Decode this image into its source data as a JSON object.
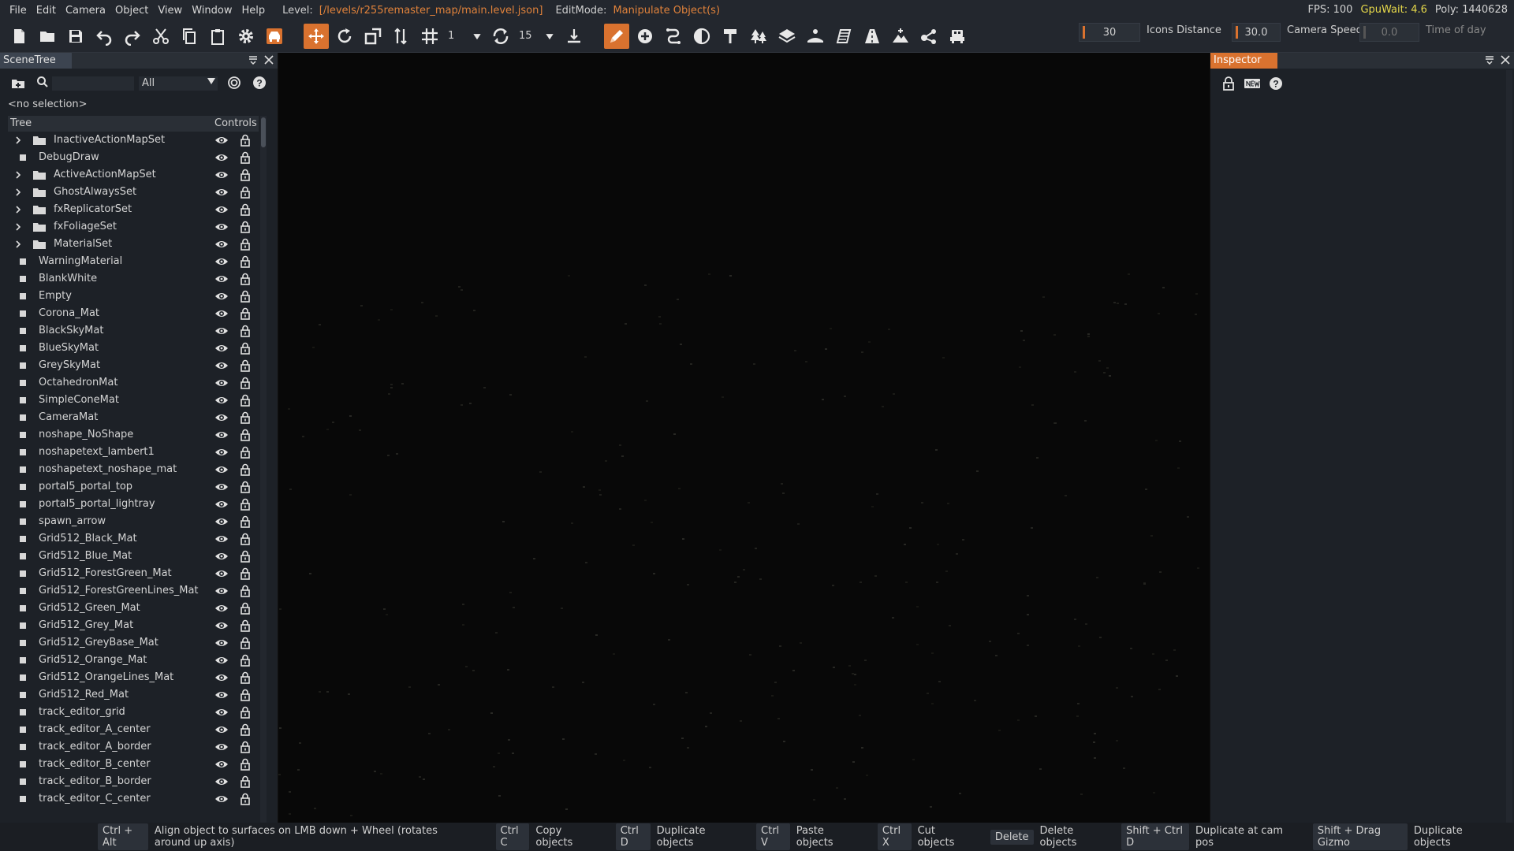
{
  "menu": {
    "items": [
      "File",
      "Edit",
      "Camera",
      "Object",
      "View",
      "Window",
      "Help"
    ],
    "level_label": "Level:",
    "level_path": "[/levels/r255remaster_map/main.level.json]",
    "editmode_label": "EditMode:",
    "editmode_value": "Manipulate Object(s)"
  },
  "stats": {
    "fps": "FPS: 100",
    "gpu_wait": "GpuWait: 4.6",
    "poly": "Poly: 1440628"
  },
  "toolbar": {
    "snap_value": "1",
    "rotate_snap_value": "15",
    "icons_distance_slider": "30",
    "icons_distance_label": "Icons Distance",
    "camera_speed_value": "30.0",
    "camera_speed_label": "Camera Speed",
    "time_value": "0.0",
    "time_label": "Time of day"
  },
  "scenetree": {
    "title": "SceneTree",
    "filter_value": "All",
    "no_selection": "<no selection>",
    "col_tree": "Tree",
    "col_controls": "Controls",
    "rows": [
      {
        "name": "InactiveActionMapSet",
        "type": "folder"
      },
      {
        "name": "DebugDraw",
        "type": "item"
      },
      {
        "name": "ActiveActionMapSet",
        "type": "folder"
      },
      {
        "name": "GhostAlwaysSet",
        "type": "folder"
      },
      {
        "name": "fxReplicatorSet",
        "type": "folder"
      },
      {
        "name": "fxFoliageSet",
        "type": "folder"
      },
      {
        "name": "MaterialSet",
        "type": "folder"
      },
      {
        "name": "WarningMaterial",
        "type": "item"
      },
      {
        "name": "BlankWhite",
        "type": "item"
      },
      {
        "name": "Empty",
        "type": "item"
      },
      {
        "name": "Corona_Mat",
        "type": "item"
      },
      {
        "name": "BlackSkyMat",
        "type": "item"
      },
      {
        "name": "BlueSkyMat",
        "type": "item"
      },
      {
        "name": "GreySkyMat",
        "type": "item"
      },
      {
        "name": "OctahedronMat",
        "type": "item"
      },
      {
        "name": "SimpleConeMat",
        "type": "item"
      },
      {
        "name": "CameraMat",
        "type": "item"
      },
      {
        "name": "noshape_NoShape",
        "type": "item"
      },
      {
        "name": "noshapetext_lambert1",
        "type": "item"
      },
      {
        "name": "noshapetext_noshape_mat",
        "type": "item"
      },
      {
        "name": "portal5_portal_top",
        "type": "item"
      },
      {
        "name": "portal5_portal_lightray",
        "type": "item"
      },
      {
        "name": "spawn_arrow",
        "type": "item"
      },
      {
        "name": "Grid512_Black_Mat",
        "type": "item"
      },
      {
        "name": "Grid512_Blue_Mat",
        "type": "item"
      },
      {
        "name": "Grid512_ForestGreen_Mat",
        "type": "item"
      },
      {
        "name": "Grid512_ForestGreenLines_Mat",
        "type": "item"
      },
      {
        "name": "Grid512_Green_Mat",
        "type": "item"
      },
      {
        "name": "Grid512_Grey_Mat",
        "type": "item"
      },
      {
        "name": "Grid512_GreyBase_Mat",
        "type": "item"
      },
      {
        "name": "Grid512_Orange_Mat",
        "type": "item"
      },
      {
        "name": "Grid512_OrangeLines_Mat",
        "type": "item"
      },
      {
        "name": "Grid512_Red_Mat",
        "type": "item"
      },
      {
        "name": "track_editor_grid",
        "type": "item"
      },
      {
        "name": "track_editor_A_center",
        "type": "item"
      },
      {
        "name": "track_editor_A_border",
        "type": "item"
      },
      {
        "name": "track_editor_B_center",
        "type": "item"
      },
      {
        "name": "track_editor_B_border",
        "type": "item"
      },
      {
        "name": "track_editor_C_center",
        "type": "item"
      }
    ]
  },
  "inspector": {
    "title": "Inspector"
  },
  "statusbar": {
    "hints": [
      {
        "key": "Ctrl + Alt",
        "desc": "Align object to surfaces on LMB down + Wheel (rotates around up axis)"
      },
      {
        "key": "Ctrl C",
        "desc": "Copy objects"
      },
      {
        "key": "Ctrl D",
        "desc": "Duplicate objects"
      },
      {
        "key": "Ctrl V",
        "desc": "Paste objects"
      },
      {
        "key": "Ctrl X",
        "desc": "Cut objects"
      },
      {
        "key": "Delete",
        "desc": "Delete objects"
      },
      {
        "key": "Shift + Ctrl D",
        "desc": "Duplicate at cam pos"
      },
      {
        "key": "Shift + Drag Gizmo",
        "desc": "Duplicate objects"
      }
    ]
  },
  "colors": {
    "accent": "#d9722f",
    "panel": "#1d2127",
    "bar": "#23272e",
    "gpu_text": "#e6d84a"
  }
}
